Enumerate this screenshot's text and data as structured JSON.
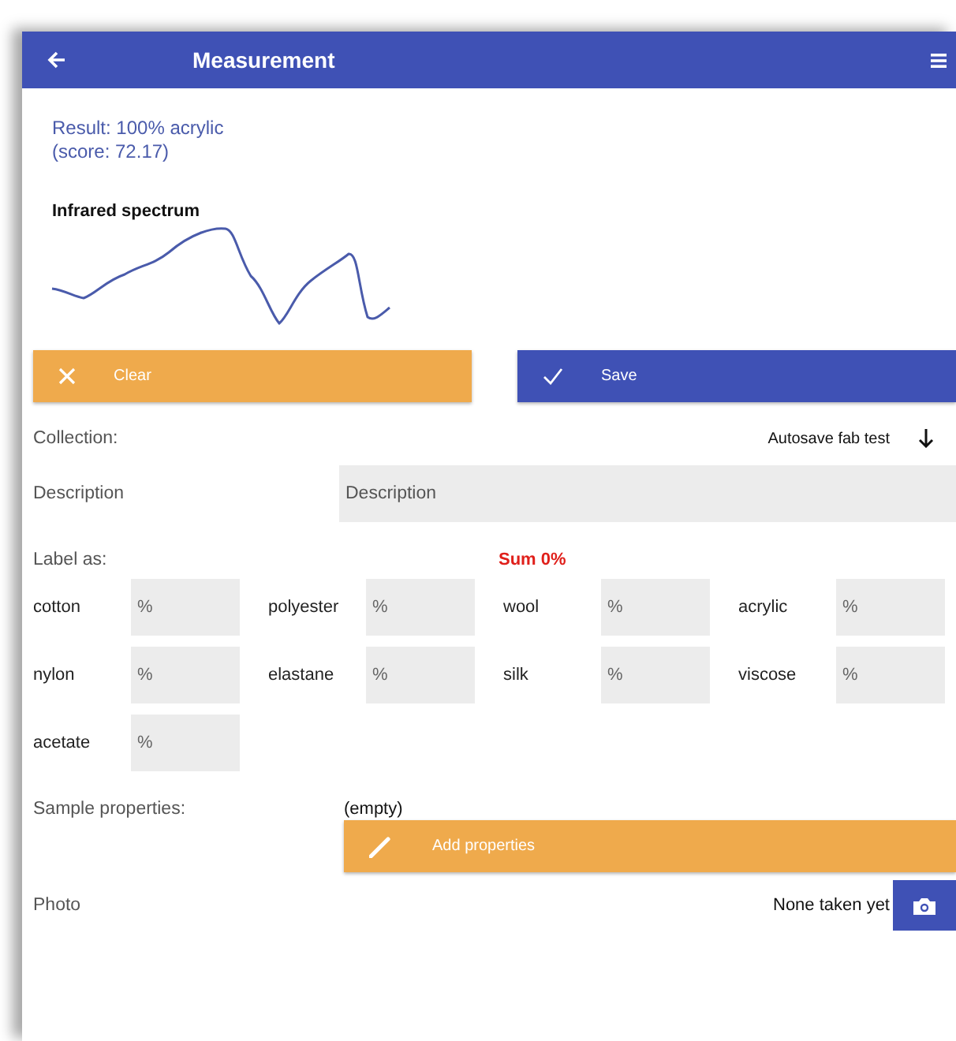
{
  "header": {
    "title": "Measurement"
  },
  "result": {
    "lines": [
      "Result: 100% acrylic",
      "(score: 72.17)"
    ]
  },
  "spectrum": {
    "title": "Infrared spectrum"
  },
  "actions": [
    {
      "label": "Clear",
      "kind": "clear"
    },
    {
      "label": "Save",
      "kind": "save"
    }
  ],
  "collection": {
    "label": "Collection:",
    "value": "Autosave fab test"
  },
  "description": {
    "label": "Description",
    "placeholder": "Description"
  },
  "label_as": {
    "label": "Label as:",
    "sum": "Sum 0%"
  },
  "fibers": [
    {
      "name": "cotton",
      "placeholder": "%"
    },
    {
      "name": "polyester",
      "placeholder": "%"
    },
    {
      "name": "wool",
      "placeholder": "%"
    },
    {
      "name": "acrylic",
      "placeholder": "%"
    },
    {
      "name": "nylon",
      "placeholder": "%"
    },
    {
      "name": "elastane",
      "placeholder": "%"
    },
    {
      "name": "silk",
      "placeholder": "%"
    },
    {
      "name": "viscose",
      "placeholder": "%"
    },
    {
      "name": "acetate",
      "placeholder": "%"
    }
  ],
  "sample_properties": {
    "label": "Sample properties:",
    "value": "(empty)",
    "button": "Add properties"
  },
  "photo": {
    "label": "Photo",
    "status": "None taken yet"
  }
}
